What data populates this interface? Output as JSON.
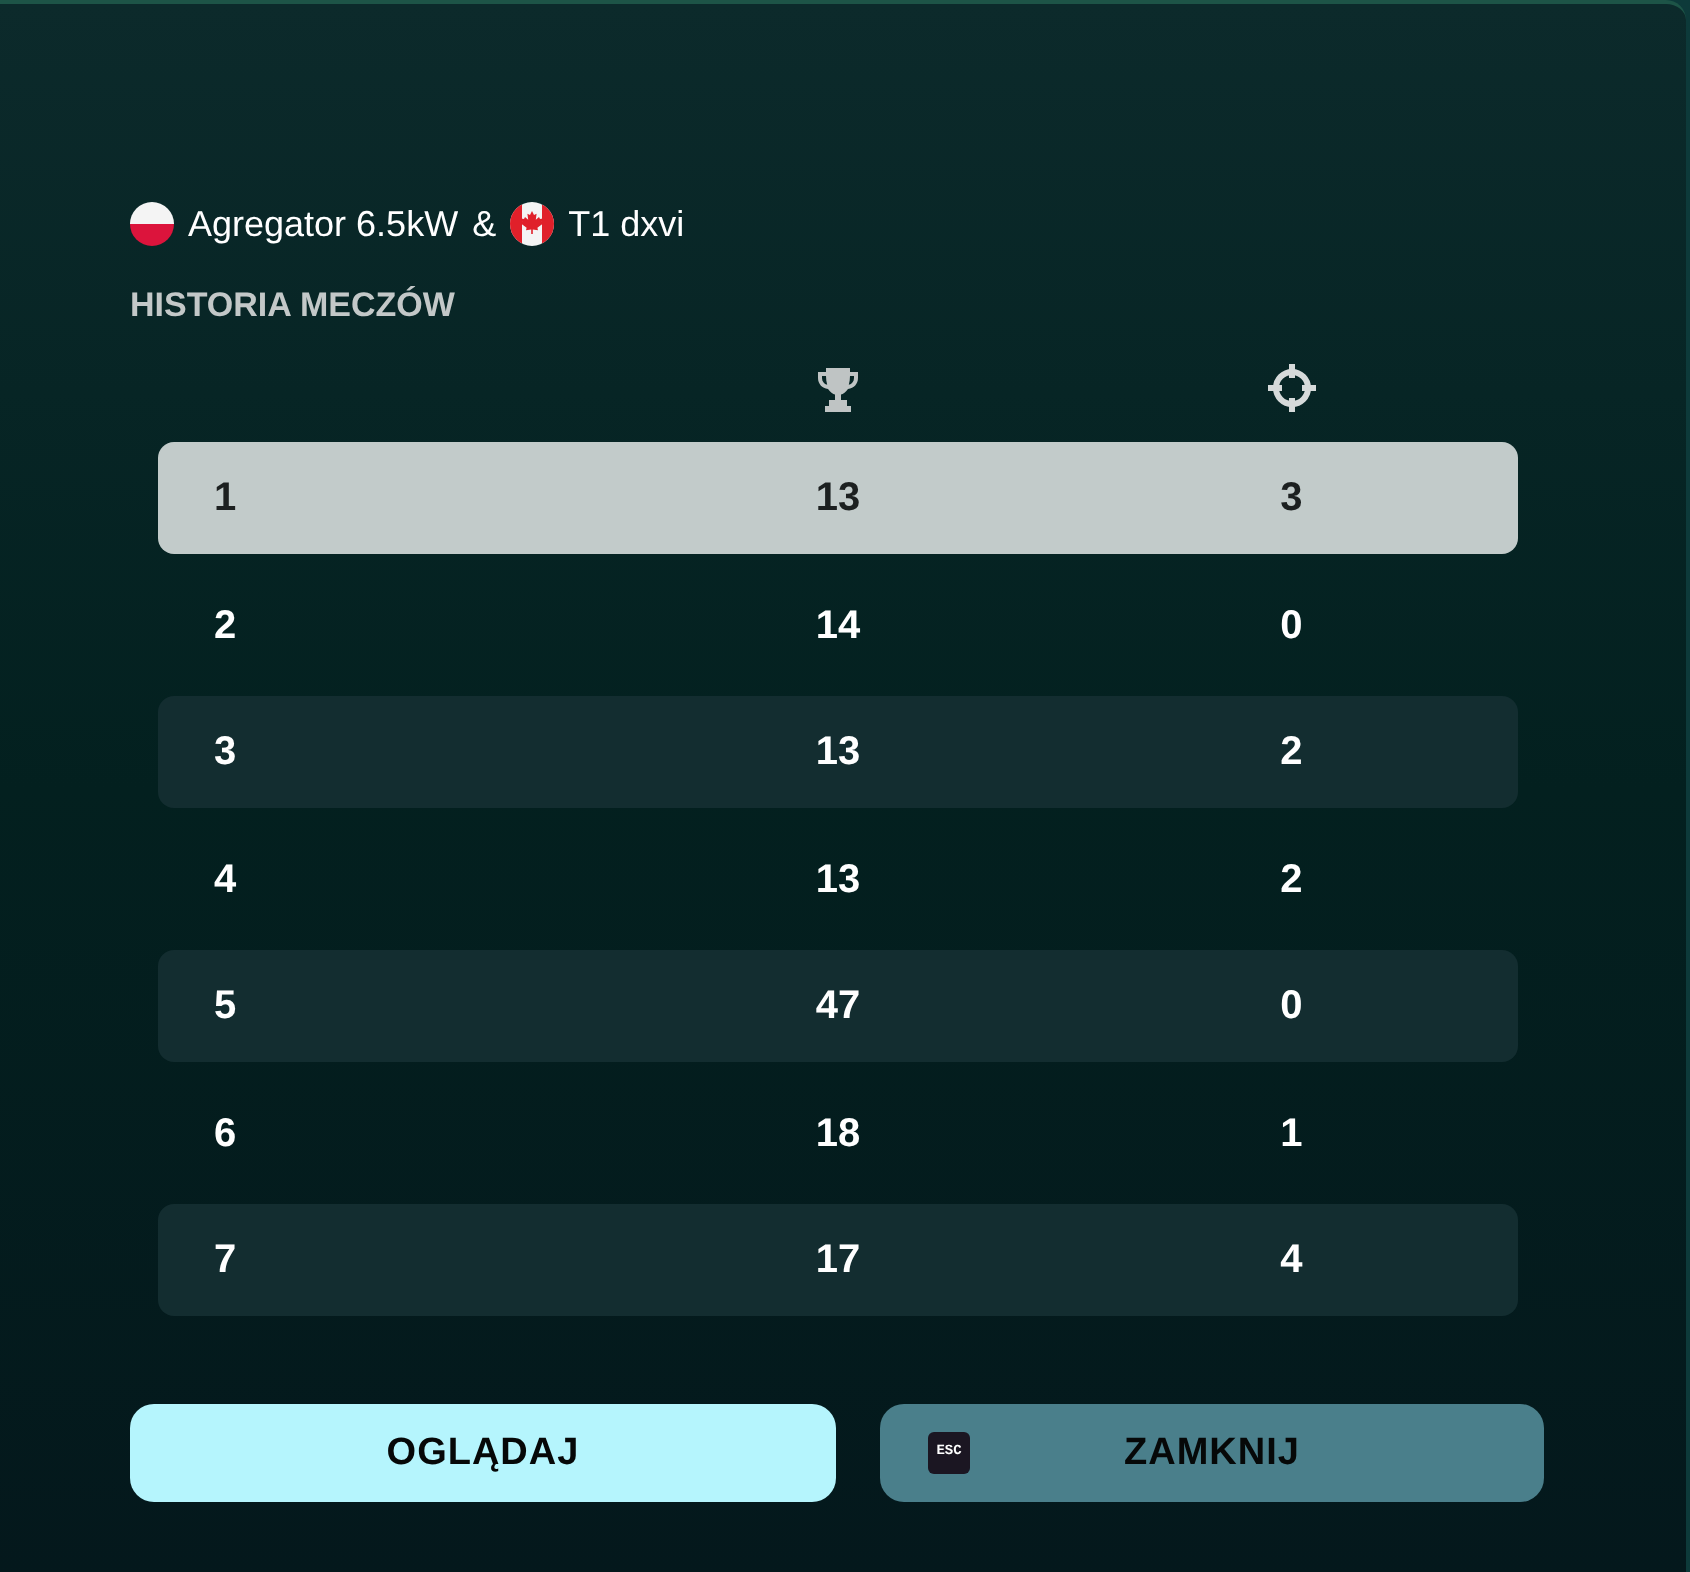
{
  "match": {
    "players": [
      {
        "name": "Agregator 6.5kW"
      },
      {
        "name": "T1 dxvi"
      }
    ],
    "separator": "&"
  },
  "section_title": "HISTORIA MECZÓW",
  "table": {
    "rows": [
      {
        "cells": [
          "1",
          "13",
          "3"
        ],
        "selected": true
      },
      {
        "cells": [
          "2",
          "14",
          "0"
        ],
        "selected": false
      },
      {
        "cells": [
          "3",
          "13",
          "2"
        ],
        "selected": false
      },
      {
        "cells": [
          "4",
          "13",
          "2"
        ],
        "selected": false
      },
      {
        "cells": [
          "5",
          "47",
          "0"
        ],
        "selected": false
      },
      {
        "cells": [
          "6",
          "18",
          "1"
        ],
        "selected": false
      },
      {
        "cells": [
          "7",
          "17",
          "4"
        ],
        "selected": false
      }
    ]
  },
  "buttons": [
    {
      "label": "OGLĄDAJ",
      "kind": "primary"
    },
    {
      "label": "ZAMKNIJ",
      "kind": "secondary",
      "key_hint": "ESC"
    }
  ]
}
